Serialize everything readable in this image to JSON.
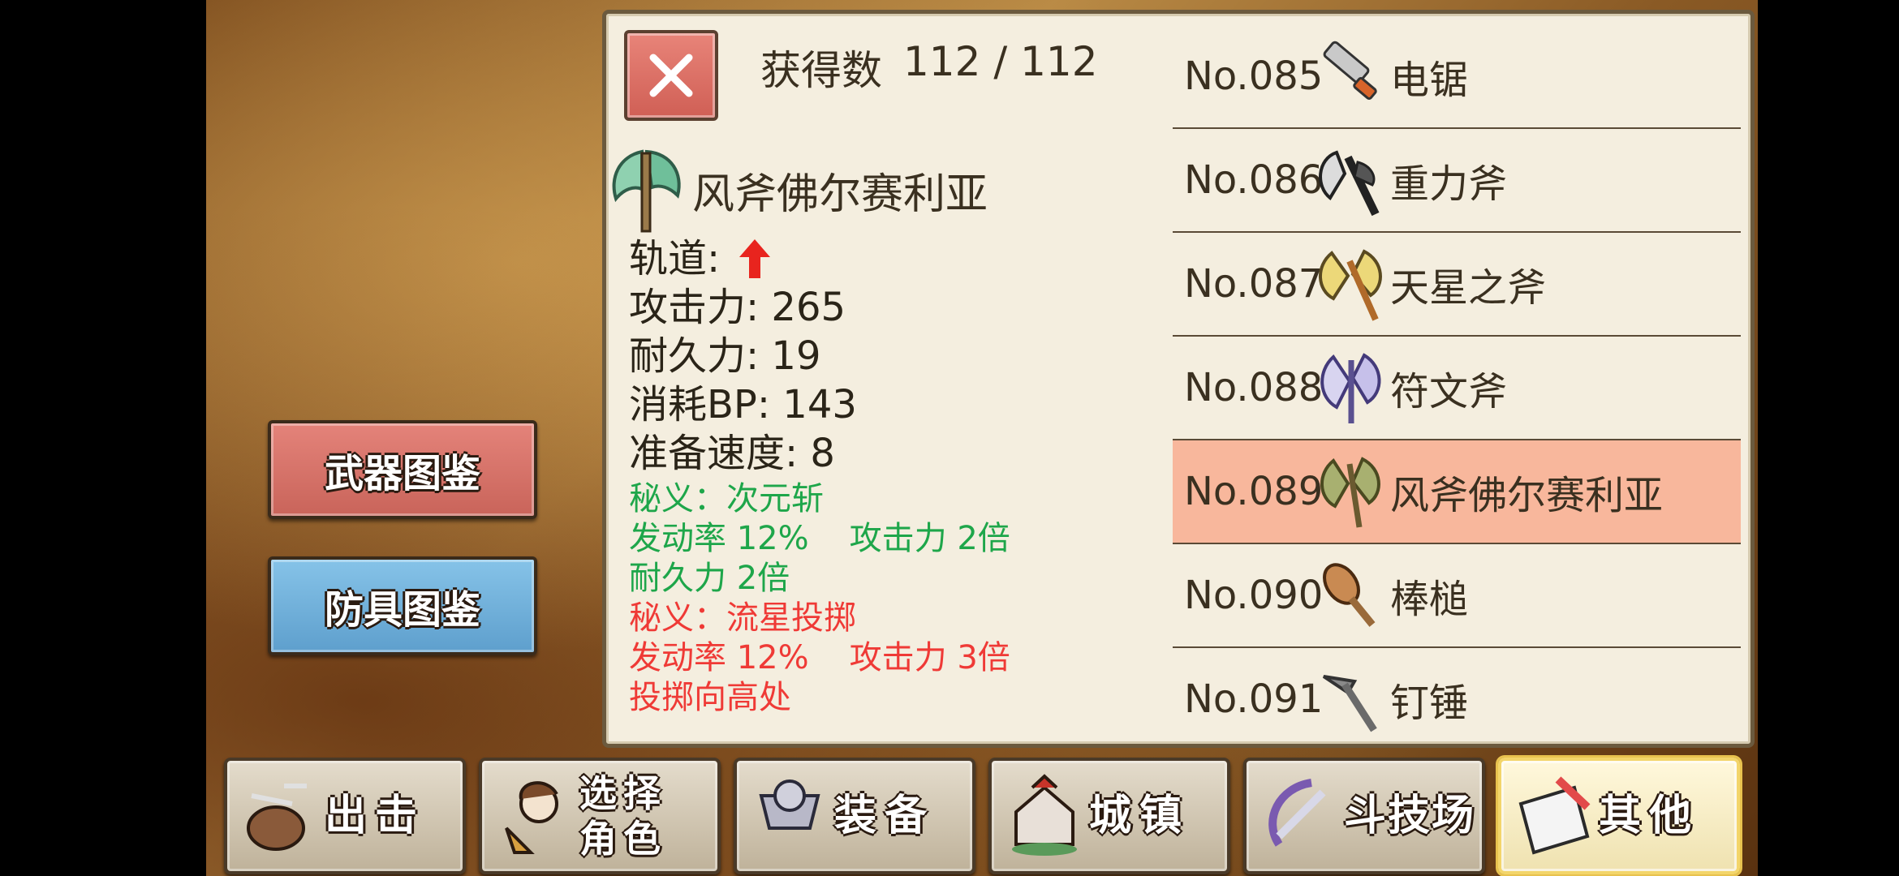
{
  "side_tabs": {
    "weapons_label": "武器图鉴",
    "armor_label": "防具图鉴"
  },
  "header": {
    "count_label": "获得数",
    "count_value": "112 / 112"
  },
  "detail": {
    "name": "风斧佛尔赛利亚",
    "trajectory_label": "轨道:",
    "attack": "攻击力: 265",
    "durability": "耐久力: 19",
    "bp_cost": "消耗BP: 143",
    "prep_speed": "准备速度: 8",
    "skill1": {
      "title": "秘义：次元斩",
      "rate": "发动率 12%",
      "effect1": "攻击力 2倍",
      "effect2": "耐久力 2倍"
    },
    "skill2": {
      "title": "秘义：流星投掷",
      "rate": "发动率 12%",
      "effect1": "攻击力 3倍",
      "effect2": "投掷向高处"
    }
  },
  "weapon_list": [
    {
      "num": "No.085",
      "name": "电锯",
      "icon": "chainsaw-icon"
    },
    {
      "num": "No.086",
      "name": "重力斧",
      "icon": "gravity-axe-icon"
    },
    {
      "num": "No.087",
      "name": "天星之斧",
      "icon": "star-axe-icon"
    },
    {
      "num": "No.088",
      "name": "符文斧",
      "icon": "rune-axe-icon"
    },
    {
      "num": "No.089",
      "name": "风斧佛尔赛利亚",
      "icon": "wind-axe-icon",
      "selected": true
    },
    {
      "num": "No.090",
      "name": "棒槌",
      "icon": "club-icon"
    },
    {
      "num": "No.091",
      "name": "钉锤",
      "icon": "mace-icon"
    }
  ],
  "bottom_nav": {
    "sortie": "出击",
    "select_char_1": "选择",
    "select_char_2": "角色",
    "equip": "装备",
    "town": "城镇",
    "arena": "斗技场",
    "other": "其他"
  },
  "colors": {
    "selected_row": "#f8b79c",
    "skill_green": "#1ea64a",
    "skill_red": "#ef3a36",
    "trajectory_arrow": "#e8241e"
  }
}
